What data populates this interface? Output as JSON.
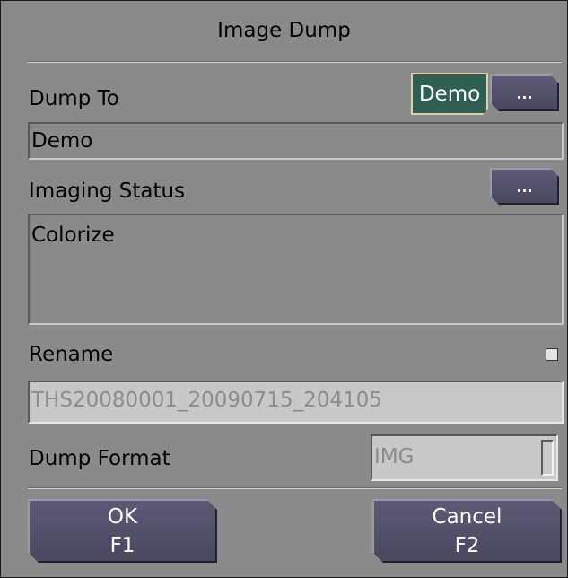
{
  "dialog": {
    "title": "Image Dump",
    "dump_to": {
      "label": "Dump To",
      "selected_button": "Demo",
      "browse_label": "...",
      "value": "Demo"
    },
    "imaging_status": {
      "label": "Imaging Status",
      "browse_label": "...",
      "value": "Colorize"
    },
    "rename": {
      "label": "Rename",
      "checked": false,
      "value": "THS20080001_20090715_204105"
    },
    "dump_format": {
      "label": "Dump Format",
      "value": "IMG"
    },
    "buttons": {
      "ok_label": "OK",
      "ok_key": "F1",
      "cancel_label": "Cancel",
      "cancel_key": "F2"
    }
  }
}
